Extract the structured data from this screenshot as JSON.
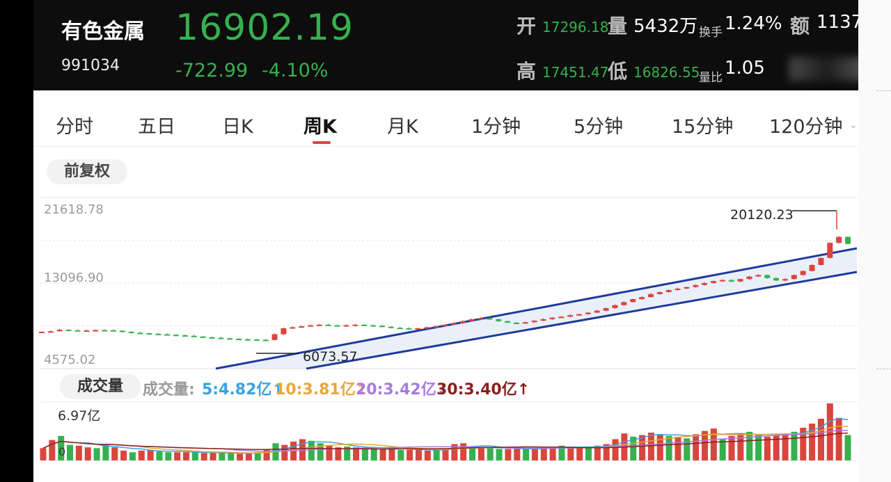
{
  "header": {
    "name": "有色金属",
    "code": "991034",
    "price": "16902.19",
    "change": "-722.99",
    "change_pct": "-4.10%",
    "open_label": "开",
    "open_value": "17296.18",
    "volume_label": "量",
    "volume_value": "5432万",
    "turnover_label": "换手",
    "turnover_value": "1.24%",
    "amount_label": "额",
    "amount_value": "1137",
    "high_label": "高",
    "high_value": "17451.47",
    "low_label": "低",
    "low_value": "16826.55",
    "ratio_label": "量比",
    "ratio_value": "1.05",
    "up_color": "#d9463c",
    "down_color": "#35b14d"
  },
  "tabs": [
    {
      "label": "分时"
    },
    {
      "label": "五日"
    },
    {
      "label": "日K"
    },
    {
      "label": "周K",
      "active": true
    },
    {
      "label": "月K"
    },
    {
      "label": "1分钟"
    },
    {
      "label": "5分钟"
    },
    {
      "label": "15分钟"
    },
    {
      "label": "120分钟"
    }
  ],
  "adjust_label": "前复权",
  "volume_panel": {
    "label": "成交量",
    "legend_prefix": "成交量:",
    "ma5": "5:4.82亿↑",
    "ma10": "10:3.81亿↑",
    "ma20": "20:3.42亿↓",
    "ma30": "30:3.40亿↑",
    "max_label": "6.97亿",
    "zero_label": "0",
    "colors": {
      "ma5": "#3aa0e0",
      "ma10": "#e8a73a",
      "ma20": "#a77be0",
      "ma30": "#8a1f1f"
    }
  },
  "chart_data": {
    "type": "candlestick",
    "y_axis_labels": [
      "21618.78",
      "13096.90",
      "4575.02"
    ],
    "ylim": [
      4575.02,
      21618.78
    ],
    "annotations": [
      {
        "text": "20120.23",
        "value": 20120.23,
        "kind": "high"
      },
      {
        "text": "6073.57",
        "value": 6073.57,
        "kind": "low"
      }
    ],
    "closes": [
      8250,
      8300,
      8450,
      8400,
      8350,
      8380,
      8420,
      8400,
      8350,
      8250,
      8150,
      8100,
      8050,
      8000,
      7950,
      7900,
      7850,
      7780,
      7700,
      7650,
      7600,
      7550,
      7500,
      7480,
      7450,
      7430,
      8000,
      8600,
      8700,
      8800,
      8900,
      8950,
      8900,
      8850,
      8900,
      8950,
      8900,
      8850,
      8750,
      8650,
      8600,
      8550,
      8600,
      8700,
      8800,
      8950,
      9100,
      9300,
      9500,
      9600,
      9500,
      9300,
      9150,
      9100,
      9200,
      9350,
      9500,
      9650,
      9750,
      9900,
      10000,
      10150,
      10350,
      10600,
      10900,
      11200,
      11500,
      11700,
      12000,
      12200,
      12400,
      12550,
      12700,
      12900,
      13100,
      13300,
      13400,
      13250,
      13500,
      13750,
      13900,
      13600,
      13350,
      13500,
      13900,
      14300,
      14900,
      15600,
      17100,
      17700,
      17000
    ],
    "volume_max": 6.97,
    "volumes": [
      1.5,
      2.5,
      3,
      1.9,
      1.8,
      1.6,
      1.5,
      2.0,
      1.6,
      1.2,
      1.0,
      1.2,
      1.3,
      1.1,
      1.0,
      1.0,
      1.0,
      1.0,
      0.9,
      0.9,
      0.9,
      0.9,
      0.8,
      0.9,
      1.0,
      1.3,
      2.1,
      1.9,
      2.3,
      2.6,
      2.4,
      2.1,
      1.8,
      1.6,
      1.7,
      1.6,
      1.5,
      1.6,
      1.4,
      1.4,
      1.3,
      1.3,
      1.3,
      1.2,
      1.3,
      1.4,
      2.0,
      2.1,
      1.7,
      1.6,
      1.5,
      1.4,
      1.4,
      1.4,
      1.4,
      1.5,
      1.6,
      1.7,
      1.8,
      1.6,
      1.5,
      1.7,
      1.8,
      2.0,
      2.6,
      3.3,
      2.9,
      3.1,
      3.4,
      3.2,
      3.0,
      2.9,
      2.7,
      3.2,
      3.6,
      3.9,
      2.6,
      3.0,
      3.3,
      3.5,
      3.2,
      2.9,
      3.1,
      3.3,
      3.5,
      4.0,
      4.5,
      5.1,
      6.97,
      5.2,
      3.1
    ],
    "vol_up": [
      1,
      1,
      0,
      0,
      1,
      1,
      0,
      0,
      1,
      1,
      0,
      1,
      1,
      0,
      0,
      1,
      1,
      0,
      1,
      1,
      0,
      0,
      1,
      1,
      0,
      1,
      0,
      1,
      1,
      1,
      0,
      0,
      1,
      1,
      0,
      1,
      0,
      0,
      1,
      1,
      0,
      1,
      1,
      1,
      0,
      1,
      1,
      1,
      0,
      1,
      0,
      0,
      1,
      1,
      0,
      1,
      1,
      1,
      0,
      1,
      1,
      0,
      1,
      1,
      1,
      1,
      0,
      1,
      1,
      1,
      0,
      1,
      0,
      1,
      1,
      1,
      0,
      1,
      1,
      0,
      0,
      1,
      1,
      1,
      0,
      1,
      1,
      1,
      1,
      1,
      0
    ]
  }
}
